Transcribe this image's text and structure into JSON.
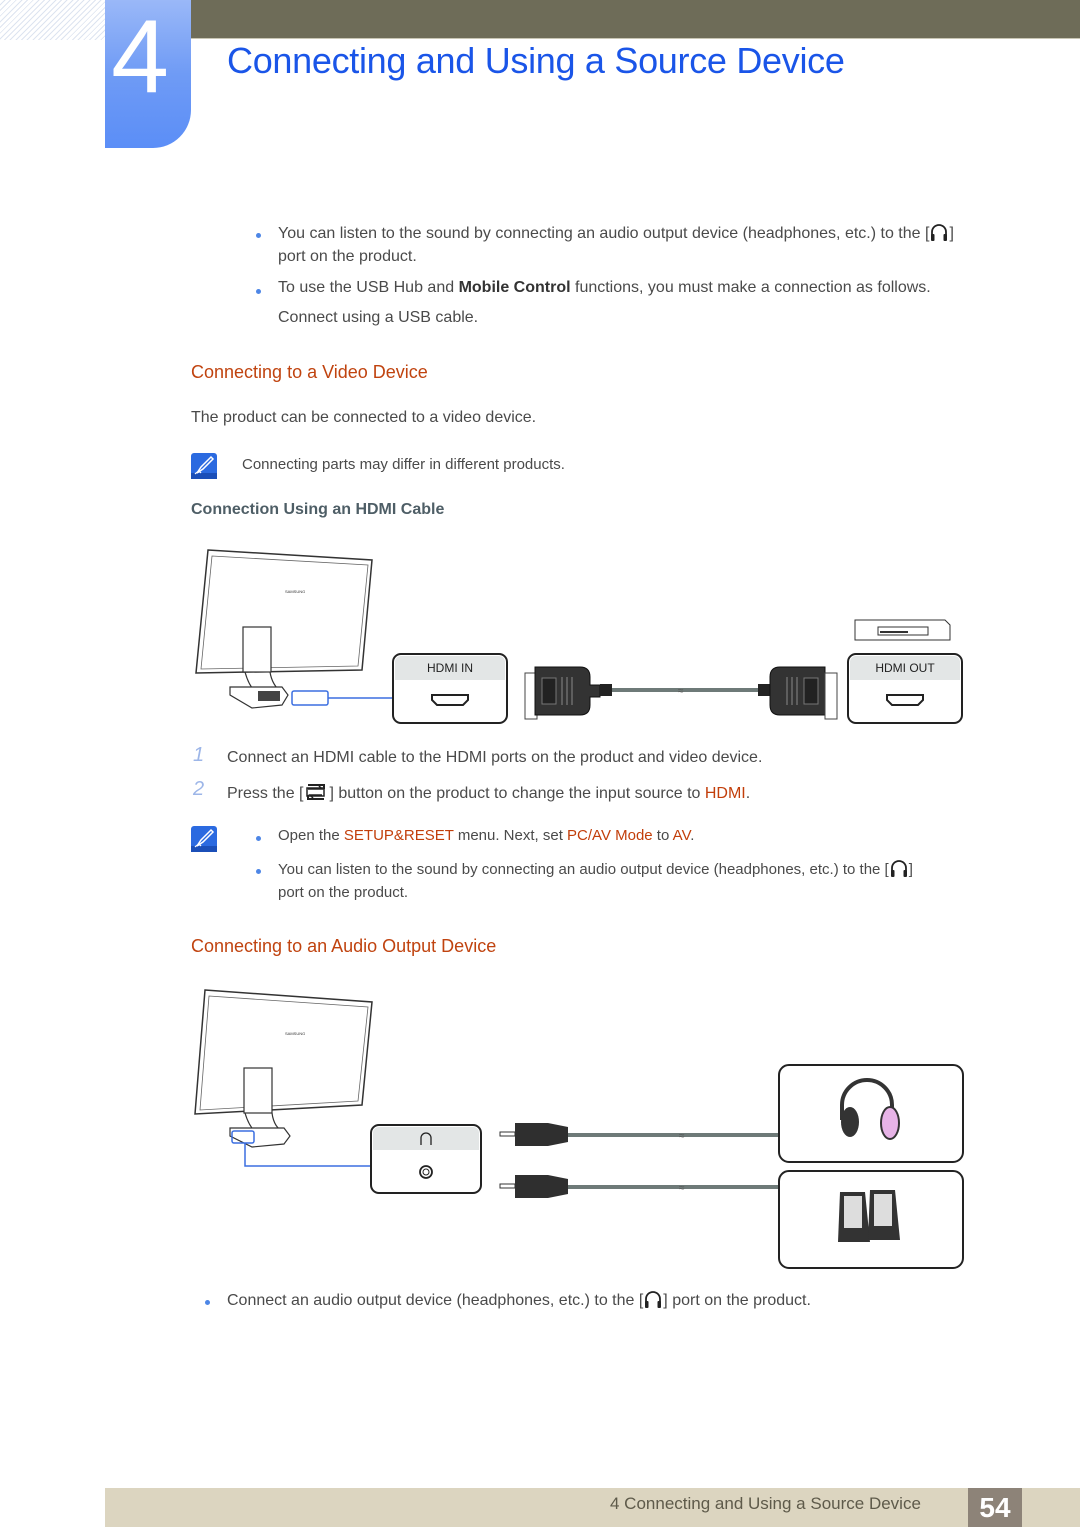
{
  "header": {
    "chapter_number": "4",
    "title": "Connecting and Using a Source Device"
  },
  "intro_bullets": [
    {
      "text_before": "You can listen to the sound by connecting an audio output device (headphones, etc.) to the [",
      "icon": "headphone-icon",
      "text_after": "]",
      "line2": "port on the product."
    },
    {
      "text_before": "To use the USB Hub and ",
      "bold": "Mobile Control",
      "text_after": " functions, you must make a connection as follows.",
      "line2": "Connect using a USB cable."
    }
  ],
  "video_section": {
    "heading": "Connecting to a Video Device",
    "description": "The product can be connected to a video device.",
    "note": "Connecting parts may differ in different products.",
    "subheading": "Connection Using an HDMI Cable",
    "diagram": {
      "port_in_label": "HDMI IN",
      "port_out_label": "HDMI OUT",
      "brand_label": "SAMSUNG"
    },
    "steps": [
      {
        "number": "1",
        "text": "Connect an HDMI cable to the HDMI ports on the product and video device."
      },
      {
        "number": "2",
        "text_before": "Press the [",
        "icon": "source-icon",
        "text_mid": "] button on the product to change the input source to ",
        "highlight": "HDMI",
        "text_after": "."
      }
    ],
    "notes": [
      {
        "t1": "Open the ",
        "h1": "SETUP&RESET",
        "t2": " menu. Next, set ",
        "h2": "PC/AV Mode",
        "t3": " to ",
        "h3": "AV",
        "t4": "."
      },
      {
        "text_before": "You can listen to the sound by connecting an audio output device (headphones, etc.) to the [",
        "icon": "headphone-icon",
        "text_after": "]",
        "line2": "port on the product."
      }
    ]
  },
  "audio_section": {
    "heading": "Connecting to an Audio Output Device",
    "diagram": {
      "brand_label": "SAMSUNG"
    },
    "bullet": {
      "text_before": "Connect an audio output device (headphones, etc.) to the [",
      "icon": "headphone-icon",
      "text_after": "] port on the product."
    }
  },
  "footer": {
    "chapter_title": "4 Connecting and Using a Source Device",
    "page_number": "54"
  },
  "colors": {
    "title_blue": "#1a55e8",
    "heading_orange": "#c0430f",
    "highlight_orange": "#c23e0a",
    "bullet_blue": "#4d86e6",
    "topbar": "#6e6c58",
    "footer": "#dcd5c0",
    "page_box": "#8d8378"
  }
}
